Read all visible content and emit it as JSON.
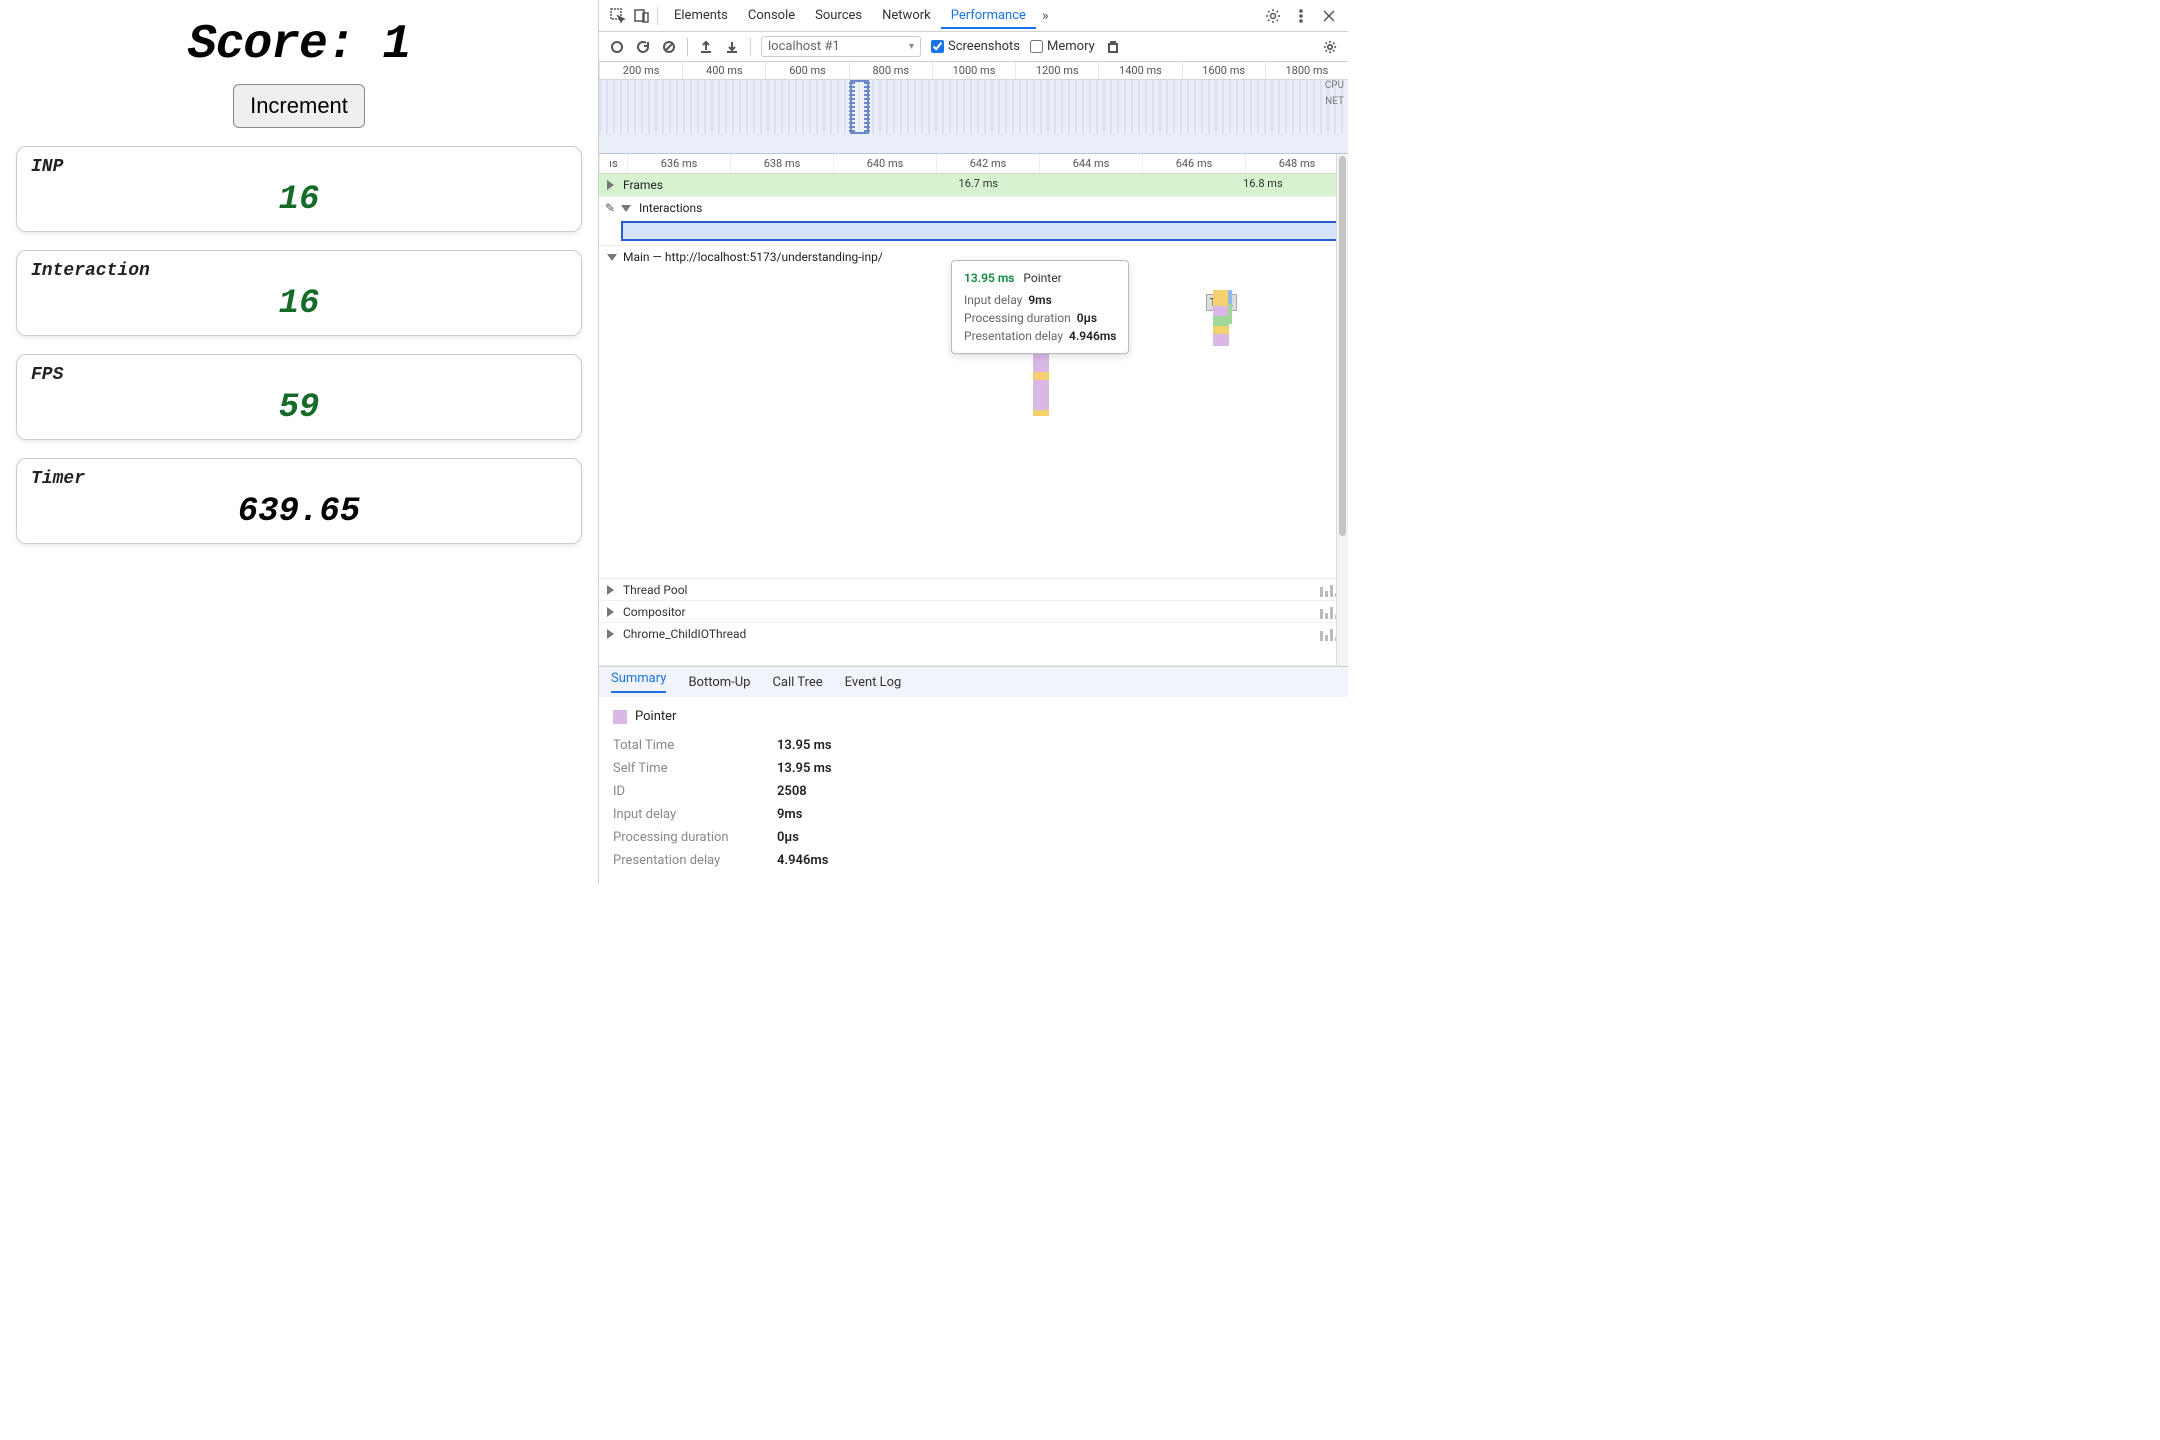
{
  "app": {
    "score_label": "Score:",
    "score_value": "1",
    "increment_label": "Increment",
    "metrics": [
      {
        "label": "INP",
        "value": "16",
        "cls": "metric-green"
      },
      {
        "label": "Interaction",
        "value": "16",
        "cls": "metric-green"
      },
      {
        "label": "FPS",
        "value": "59",
        "cls": "metric-green"
      },
      {
        "label": "Timer",
        "value": "639.65",
        "cls": "metric-black"
      }
    ]
  },
  "devtools": {
    "tabs": [
      "Elements",
      "Console",
      "Sources",
      "Network",
      "Performance"
    ],
    "active_tab": "Performance",
    "toolbar": {
      "target": "localhost #1",
      "screenshots_label": "Screenshots",
      "screenshots_checked": true,
      "memory_label": "Memory",
      "memory_checked": false
    },
    "overview": {
      "ticks": [
        "200 ms",
        "400 ms",
        "600 ms",
        "800 ms",
        "1000 ms",
        "1200 ms",
        "1400 ms",
        "1600 ms",
        "1800 ms"
      ],
      "cpu_label": "CPU",
      "net_label": "NET",
      "window_start_pct": 33.5,
      "window_width_pct": 2.6
    },
    "flame": {
      "ruler": [
        "636 ms",
        "638 ms",
        "640 ms",
        "642 ms",
        "644 ms",
        "646 ms",
        "648 ms"
      ],
      "ruler_prefix": "ıs",
      "frames_label": "Frames",
      "frame_times": [
        {
          "text": "16.7 ms",
          "left_pct": 48
        },
        {
          "text": "16.8 ms",
          "left_pct": 86
        }
      ],
      "interactions_label": "Interactions",
      "main_label": "Main — http://localhost:5173/understanding-inp/",
      "task_badge": "Task",
      "task_left_pct": 81,
      "threads": [
        {
          "name": "Thread Pool"
        },
        {
          "name": "Compositor"
        },
        {
          "name": "Chrome_ChildIOThread"
        }
      ]
    },
    "tooltip": {
      "time": "13.95 ms",
      "type": "Pointer",
      "rows": [
        {
          "k": "Input delay",
          "v": "9ms"
        },
        {
          "k": "Processing duration",
          "v": "0µs"
        },
        {
          "k": "Presentation delay",
          "v": "4.946ms"
        }
      ]
    },
    "details": {
      "tabs": [
        "Summary",
        "Bottom-Up",
        "Call Tree",
        "Event Log"
      ],
      "active_tab": "Summary",
      "pointer_label": "Pointer",
      "rows": [
        {
          "k": "Total Time",
          "v": "13.95 ms"
        },
        {
          "k": "Self Time",
          "v": "13.95 ms"
        },
        {
          "k": "ID",
          "v": "2508"
        },
        {
          "k": "Input delay",
          "v": "9ms"
        },
        {
          "k": "Processing duration",
          "v": "0µs"
        },
        {
          "k": "Presentation delay",
          "v": "4.946ms"
        }
      ]
    }
  }
}
